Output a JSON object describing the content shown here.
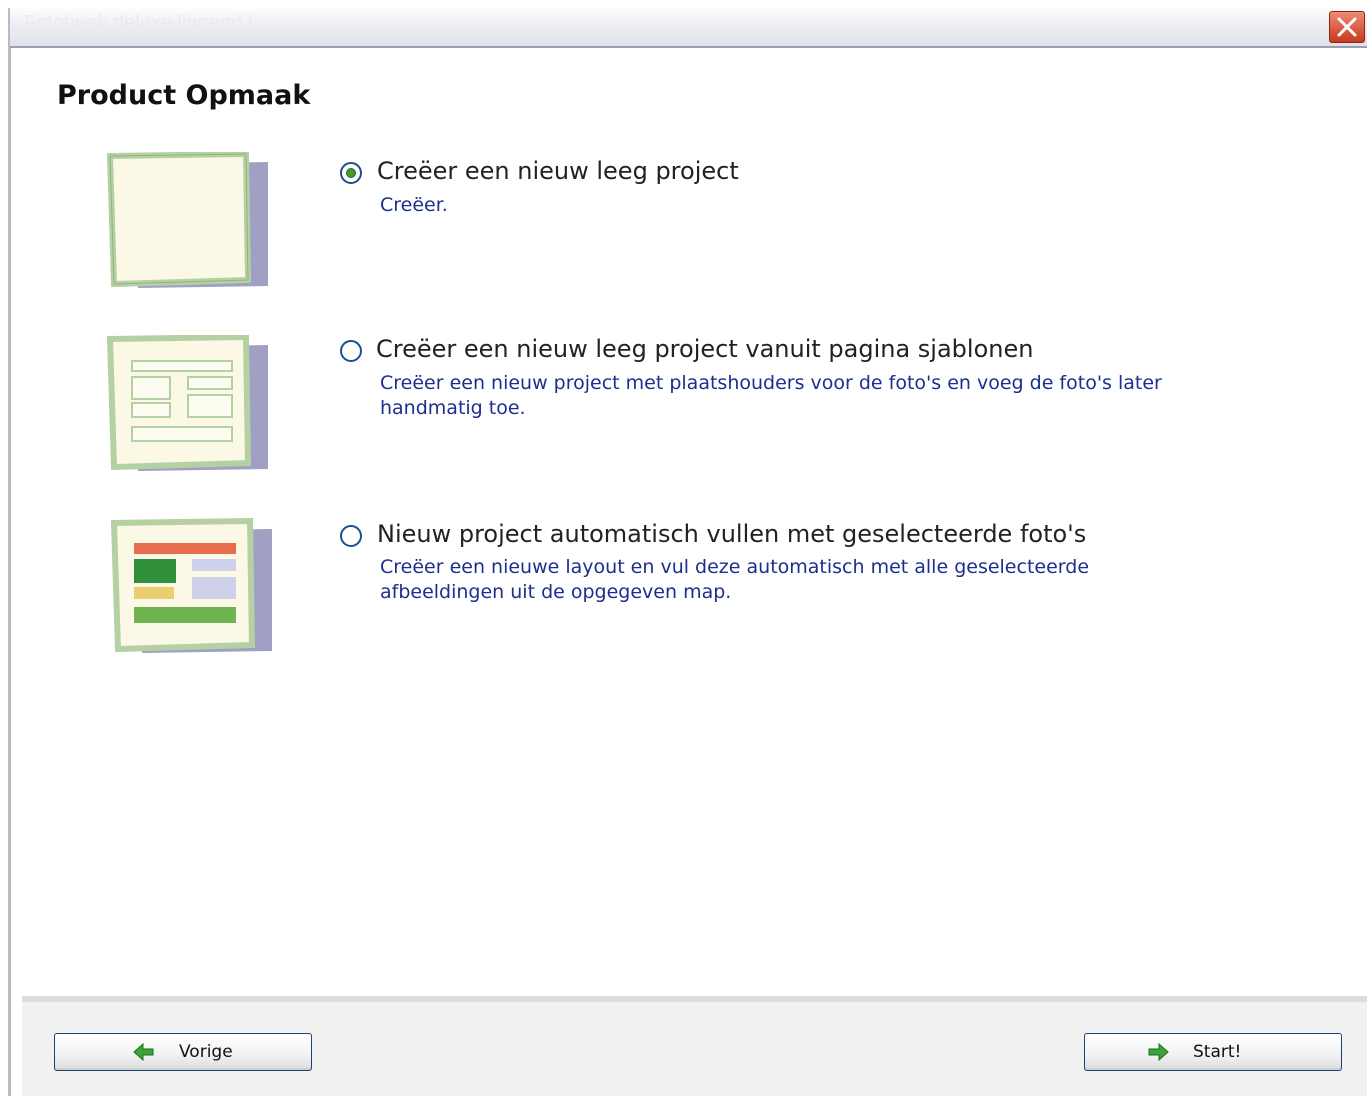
{
  "window": {
    "title": "Fotoboek deluxe liggend I",
    "close_icon": "close-icon"
  },
  "page": {
    "title": "Product Opmaak"
  },
  "options": [
    {
      "label": "Creëer een nieuw leeg project",
      "description": "Creëer.",
      "selected": true,
      "thumbnail_icon": "blank-page-icon"
    },
    {
      "label": "Creëer een nieuw leeg project vanuit pagina sjablonen",
      "description": "Creëer een nieuw project met plaatshouders voor de foto's en voeg de foto's later handmatig toe.",
      "selected": false,
      "thumbnail_icon": "template-page-icon"
    },
    {
      "label": "Nieuw project automatisch vullen met geselecteerde foto's",
      "description": "Creëer een nieuwe layout en vul deze automatisch met alle geselecteerde afbeeldingen uit de opgegeven map.",
      "selected": false,
      "thumbnail_icon": "auto-filled-page-icon"
    }
  ],
  "footer": {
    "back_label": "Vorige",
    "back_icon": "arrow-left-icon",
    "start_label": "Start!",
    "start_icon": "arrow-right-icon"
  },
  "colors": {
    "description_text": "#1c2f8f",
    "radio_selected": "#3f9a2f",
    "close_button": "#c73a1e"
  }
}
